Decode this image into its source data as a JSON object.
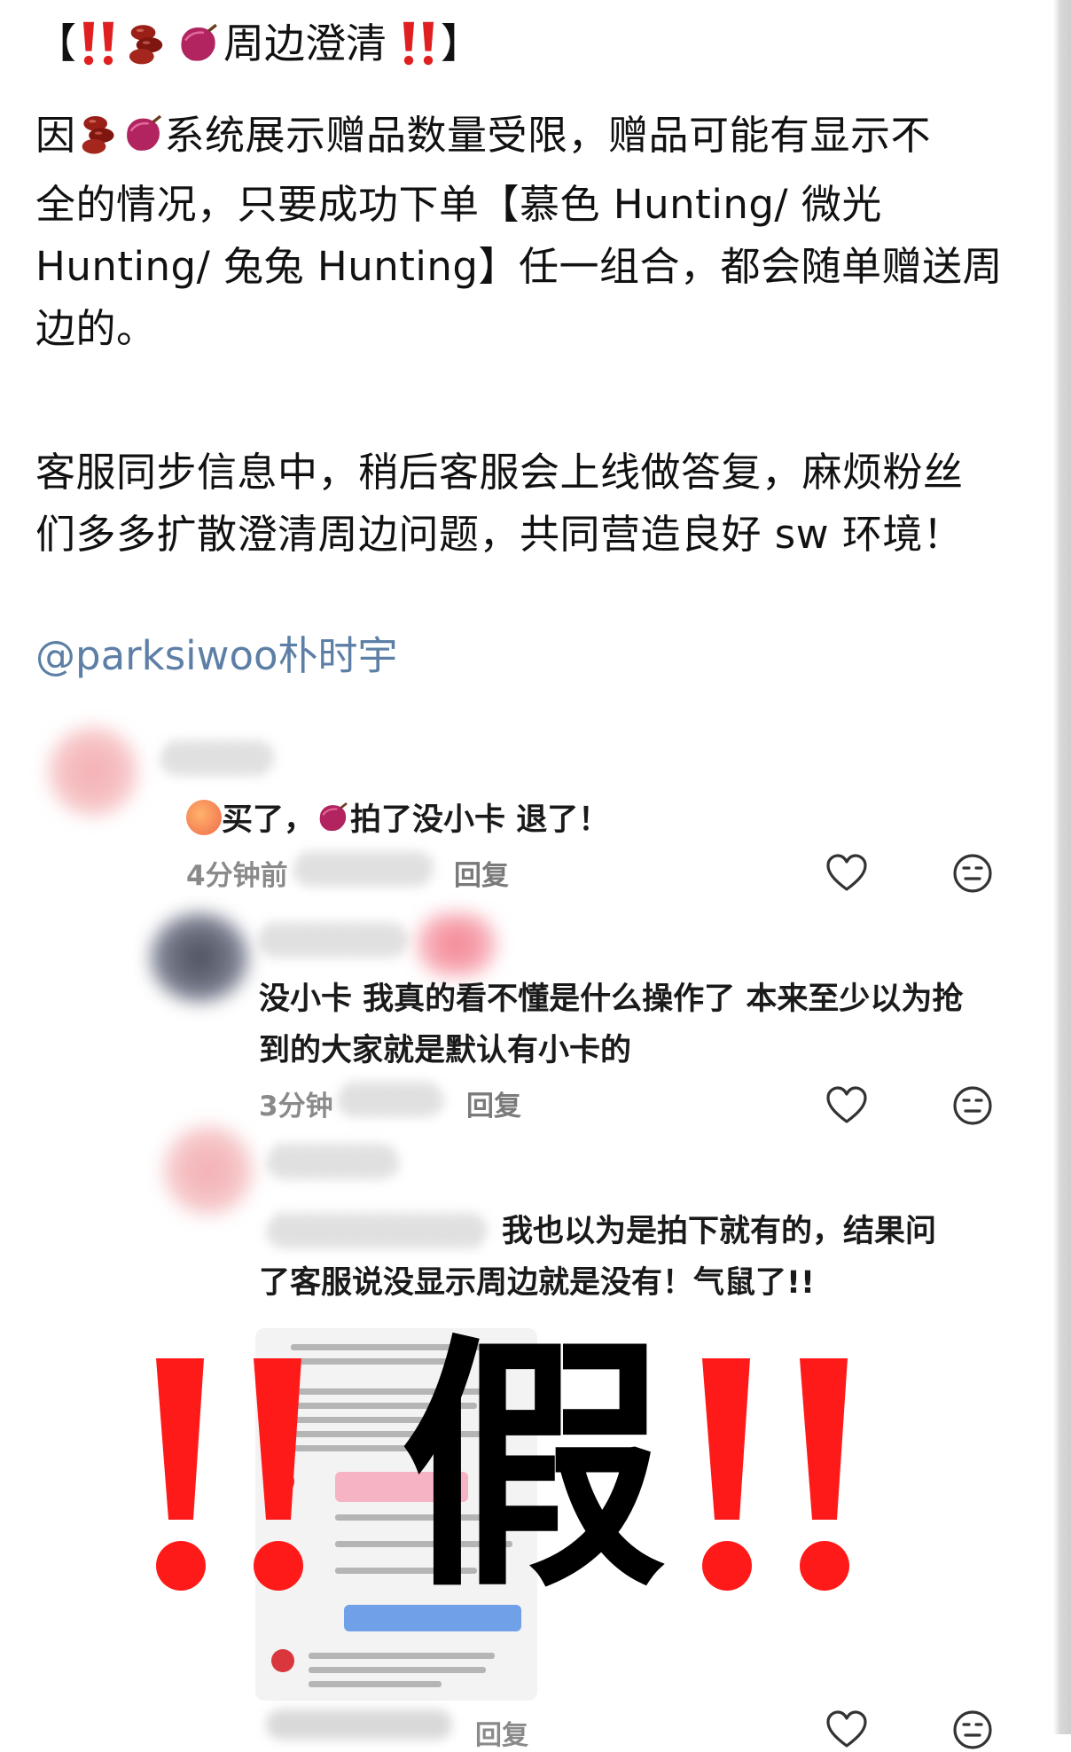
{
  "post": {
    "title": {
      "open_bracket": "【",
      "text": "周边澄清",
      "close_bracket": "】"
    },
    "paragraph1": {
      "lead": "因",
      "rest_line1": "系统展示赠品数量受限，赠品可能有显示不",
      "line2": "全的情况，只要成功下单【慕色 Hunting/ 微光",
      "line3": " Hunting/ 兔兔 Hunting】任一组合，都会随单赠送周",
      "line4": "边的。"
    },
    "paragraph2": {
      "line1": "客服同步信息中，稍后客服会上线做答复，麻烦粉丝",
      "line2": "们多多扩散澄清周边问题，共同营造良好 sw 环境！"
    },
    "mention": "@parksiwoo朴时宇"
  },
  "comments": [
    {
      "text_part1": "买了，",
      "text_part2": "拍了没小卡 退了！",
      "time": "4分钟前",
      "reply": "回复"
    },
    {
      "line1": "没小卡 我真的看不懂是什么操作了 本来至少以为抢",
      "line2": "到的大家就是默认有小卡的",
      "time": "3分钟",
      "reply": "回复"
    },
    {
      "line1": "我也以为是拍下就有的，结果问",
      "line2": "了客服说没显示周边就是没有！气鼠了!!"
    }
  ],
  "overlay": {
    "big_char": "假"
  },
  "bottom": {
    "reply": "回复"
  },
  "icons": {
    "emoji_beans": "beans-icon",
    "emoji_sweet_potato": "sweet-potato-icon",
    "emoji_peach": "peach-icon",
    "heart": "heart-icon",
    "meh_face": "neutral-face-icon",
    "double_exclamation": "double-exclamation-icon"
  },
  "colors": {
    "mention": "#5d7fa6",
    "exclamation_red": "#e02020",
    "overlay_red": "#ff1a1a"
  }
}
